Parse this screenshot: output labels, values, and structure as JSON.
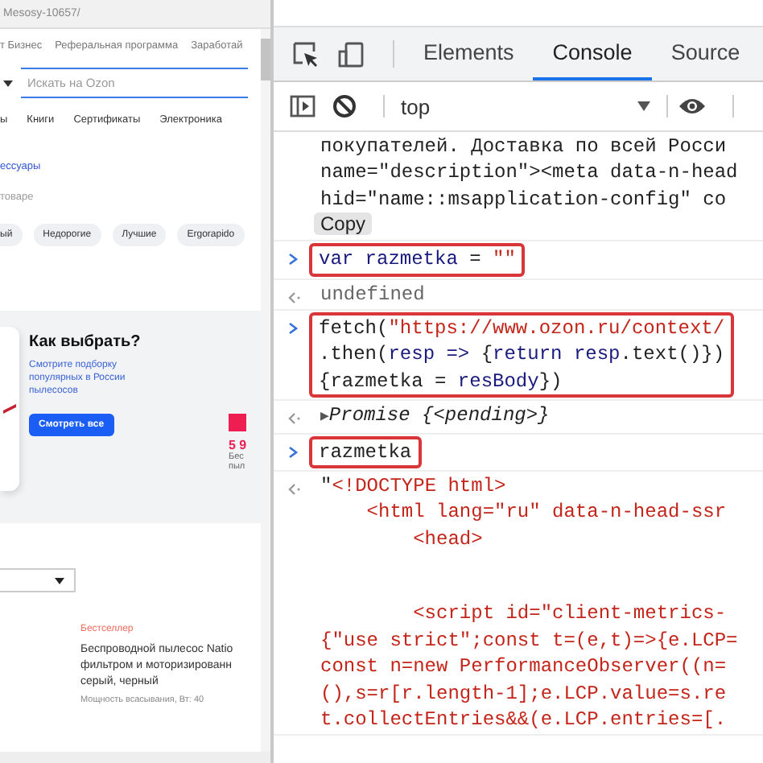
{
  "browser": {
    "url": "Mesosy-10657/"
  },
  "site": {
    "top_links": [
      "т Бизнес",
      "Реферальная программа",
      "Заработай"
    ],
    "search_placeholder": "Искать на Ozon",
    "categories": [
      "ы",
      "Книги",
      "Сертификаты",
      "Электроника"
    ],
    "breadcrumb": "ессуары",
    "count": "товаре",
    "chips": [
      "ый",
      "Недорогие",
      "Лучшие",
      "Ergorapido"
    ],
    "promo": {
      "title": "Как выбрать?",
      "text": "Смотрите подборку популярных в России пылесосов",
      "button": "Смотреть все"
    },
    "side_product": {
      "price": "5 9",
      "lines": [
        "Бес",
        "пыл"
      ]
    },
    "product": {
      "badge": "Бестселлер",
      "title_lines": [
        "Беспроводной пылесос Natio",
        "фильтром и моторизированн",
        "серый, черный"
      ],
      "specs": [
        "Мощность всасывания, Вт: 40"
      ]
    }
  },
  "devtools": {
    "tabs": [
      {
        "label": "Elements",
        "selected": false
      },
      {
        "label": "Console",
        "selected": true
      },
      {
        "label": "Source",
        "selected": false
      }
    ],
    "context": "top",
    "entries": [
      {
        "kind": "output",
        "lines": [
          {
            "tokens": [
              {
                "kind": "plain",
                "text": "покупателей. Доставка по всей Росси"
              }
            ]
          },
          {
            "tokens": [
              {
                "kind": "plain",
                "text": "name=\"description\"><meta data-n-head"
              }
            ]
          },
          {
            "tokens": [
              {
                "kind": "plain",
                "text": "hid=\"name::msapplication-config\" co"
              }
            ]
          }
        ],
        "copy": "Copy"
      },
      {
        "kind": "input",
        "highlighted": true,
        "lines": [
          {
            "tokens": [
              {
                "kind": "name",
                "text": "var razmetka"
              },
              {
                "kind": "plain",
                "text": " = "
              },
              {
                "kind": "string",
                "text": "\"\""
              }
            ]
          }
        ]
      },
      {
        "kind": "result",
        "lines": [
          {
            "tokens": [
              {
                "kind": "muted",
                "text": "undefined"
              }
            ]
          }
        ]
      },
      {
        "kind": "input",
        "highlighted": true,
        "lines": [
          {
            "tokens": [
              {
                "kind": "plain",
                "text": "fetch("
              },
              {
                "kind": "string",
                "text": "\"https://www.ozon.ru/context/"
              }
            ]
          },
          {
            "tokens": [
              {
                "kind": "plain",
                "text": ".then("
              },
              {
                "kind": "name",
                "text": "resp =>"
              },
              {
                "kind": "plain",
                "text": " {"
              },
              {
                "kind": "name",
                "text": "return resp"
              },
              {
                "kind": "plain",
                "text": ".text()})"
              }
            ]
          },
          {
            "tokens": [
              {
                "kind": "plain",
                "text": "{razmetka = "
              },
              {
                "kind": "name",
                "text": "resBody"
              },
              {
                "kind": "plain",
                "text": "})"
              }
            ]
          }
        ]
      },
      {
        "kind": "result",
        "toggle": "▶",
        "lines": [
          {
            "tokens": [
              {
                "kind": "italic",
                "text": "Promise {<pending>}"
              }
            ]
          }
        ]
      },
      {
        "kind": "input",
        "highlighted": true,
        "lines": [
          {
            "tokens": [
              {
                "kind": "plain",
                "text": "razmetka"
              }
            ]
          }
        ]
      },
      {
        "kind": "result",
        "lines": [
          {
            "tokens": [
              {
                "kind": "plain",
                "text": "\""
              },
              {
                "kind": "string",
                "text": "<!DOCTYPE html>"
              }
            ]
          },
          {
            "tokens": [
              {
                "kind": "string",
                "text": "    <html lang=\"ru\" data-n-head-ssr"
              }
            ]
          },
          {
            "tokens": [
              {
                "kind": "string",
                "text": "        <head>"
              }
            ]
          }
        ],
        "continuation": [
          {
            "tokens": [
              {
                "kind": "string",
                "text": "        <script id=\"client-metrics-"
              }
            ]
          },
          {
            "tokens": [
              {
                "kind": "string",
                "text": "{\"use strict\";const t=(e,t)=>{e.LCP="
              }
            ]
          },
          {
            "tokens": [
              {
                "kind": "string",
                "text": "const n=new PerformanceObserver((n="
              }
            ]
          },
          {
            "tokens": [
              {
                "kind": "string",
                "text": "(),s=r[r.length-1];e.LCP.value=s.re"
              }
            ]
          },
          {
            "tokens": [
              {
                "kind": "string",
                "text": "t.collectEntries&&(e.LCP.entries=[."
              }
            ]
          }
        ]
      }
    ]
  }
}
